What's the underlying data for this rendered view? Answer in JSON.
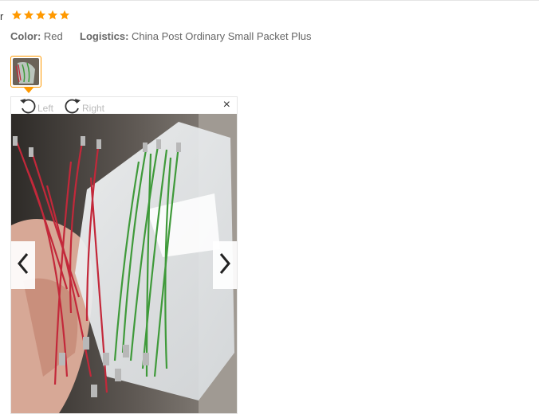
{
  "review": {
    "name_fragment": "r",
    "rating": 5,
    "colors": {
      "star": "#ff9900",
      "accent": "#ff9900"
    },
    "attributes": [
      {
        "key": "Color:",
        "value": "Red"
      },
      {
        "key": "Logistics:",
        "value": "China Post Ordinary Small Packet Plus"
      }
    ]
  },
  "viewer": {
    "rotate_left_label": "Left",
    "rotate_right_label": "Right",
    "close_glyph": "×",
    "icons": [
      "rotate-left-icon",
      "rotate-right-icon",
      "close-icon",
      "chevron-left-icon",
      "chevron-right-icon"
    ]
  }
}
